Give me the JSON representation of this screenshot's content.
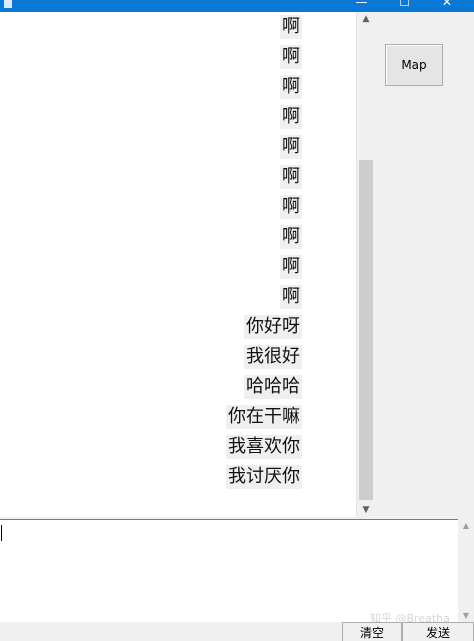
{
  "window": {
    "title": "",
    "controls": "— ☐ ✕"
  },
  "chat": {
    "messages": [
      "啊",
      "啊",
      "啊",
      "啊",
      "啊",
      "啊",
      "啊",
      "啊",
      "啊",
      "啊",
      "你好呀",
      "我很好",
      "哈哈哈",
      "你在干嘛",
      "我喜欢你",
      "我讨厌你"
    ]
  },
  "icons": {
    "scroll_up": "▲",
    "scroll_down": "▼"
  },
  "buttons": {
    "map": "Map",
    "clear": "清空",
    "send": "发送"
  },
  "input": {
    "value": ""
  },
  "watermark": "知乎 @Breatha"
}
